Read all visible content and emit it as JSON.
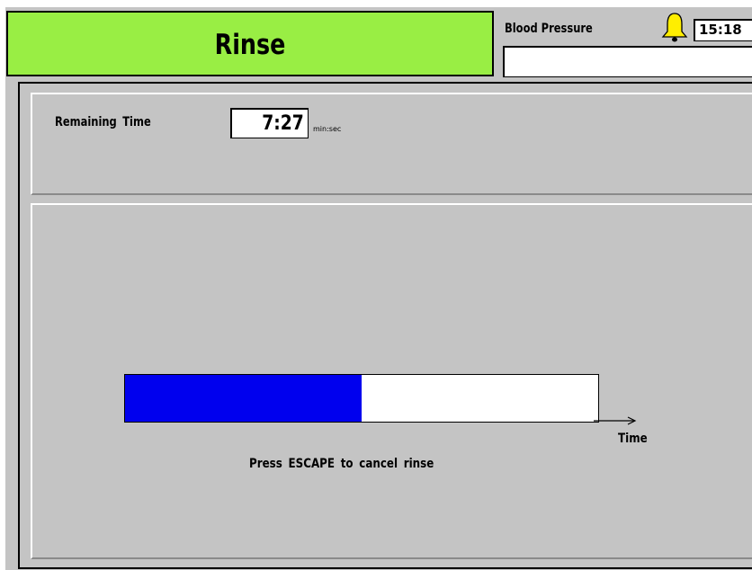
{
  "header": {
    "title": "Rinse",
    "title_bg_color": "#99ee44",
    "blood_pressure_label": "Blood Pressure",
    "blood_pressure_value": "",
    "alarm_icon": "bell-icon",
    "clock": "15:18"
  },
  "remaining": {
    "label": "Remaining Time",
    "value": "7:27",
    "unit": "min:sec"
  },
  "progress": {
    "fraction": 0.5,
    "fill_color": "#0000ee",
    "axis_label": "Time"
  },
  "hint": "Press ESCAPE to cancel rinse"
}
